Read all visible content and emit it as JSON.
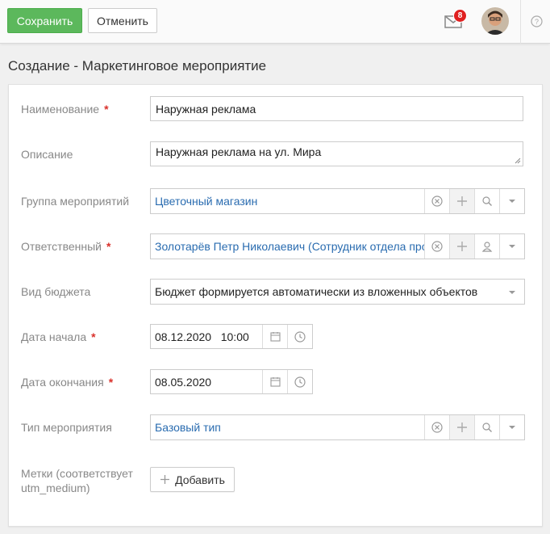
{
  "toolbar": {
    "save_label": "Сохранить",
    "cancel_label": "Отменить",
    "notifications_count": "8"
  },
  "page": {
    "title": "Создание - Маркетинговое мероприятие"
  },
  "form": {
    "name": {
      "label": "Наименование",
      "required": "*",
      "value": "Наружная реклама"
    },
    "description": {
      "label": "Описание",
      "value": "Наружная реклама на ул. Мира"
    },
    "group": {
      "label": "Группа мероприятий",
      "value": "Цветочный магазин"
    },
    "responsible": {
      "label": "Ответственный",
      "required": "*",
      "value": "Золотарёв Петр Николаевич (Сотрудник отдела продаж)"
    },
    "budget_type": {
      "label": "Вид бюджета",
      "value": "Бюджет формируется автоматически из вложенных объектов"
    },
    "start_date": {
      "label": "Дата начала",
      "required": "*",
      "value": "08.12.2020   10:00"
    },
    "end_date": {
      "label": "Дата окончания",
      "required": "*",
      "value": "08.05.2020"
    },
    "event_type": {
      "label": "Тип мероприятия",
      "value": "Базовый тип"
    },
    "tags": {
      "label_line1": "Метки (соответствует",
      "label_line2": "utm_medium)",
      "add_label": "Добавить"
    }
  },
  "colors": {
    "primary_green": "#5cb85c",
    "link_blue": "#2a6cb0",
    "required_red": "#d9302a",
    "badge_red": "#e02020"
  },
  "icons": [
    "mail-icon",
    "avatar",
    "help-icon",
    "clear-icon",
    "plus-icon",
    "search-icon",
    "user-icon",
    "chevron-down-icon",
    "calendar-icon",
    "clock-icon"
  ]
}
